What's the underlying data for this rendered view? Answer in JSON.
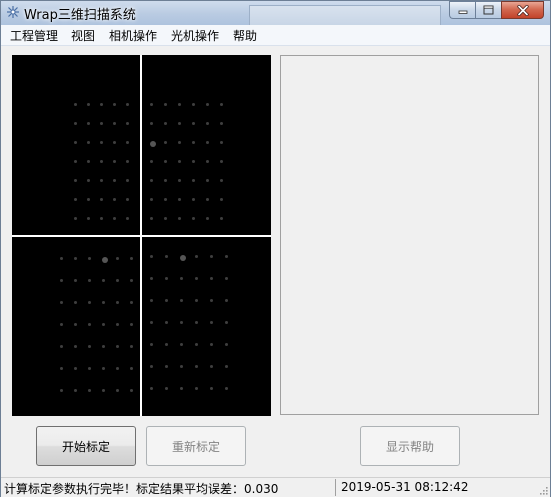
{
  "window": {
    "title": "Wrap三维扫描系统"
  },
  "menu": {
    "items": [
      "工程管理",
      "视图",
      "相机操作",
      "光机操作",
      "帮助"
    ]
  },
  "buttons": {
    "start_calibration": "开始标定",
    "recalibrate": "重新标定",
    "show_help": "显示帮助"
  },
  "status": {
    "message": "计算标定参数执行完毕！标定结果平均误差：0.030",
    "datetime": "2019-05-31 08:12:42"
  },
  "colors": {
    "camera_bg": "#000000",
    "crosshair": "#ffffff",
    "panel_bg": "#f0f0f0"
  },
  "icons": [
    "app-icon",
    "minimize-icon",
    "maximize-icon",
    "close-icon",
    "resize-grip-icon"
  ]
}
